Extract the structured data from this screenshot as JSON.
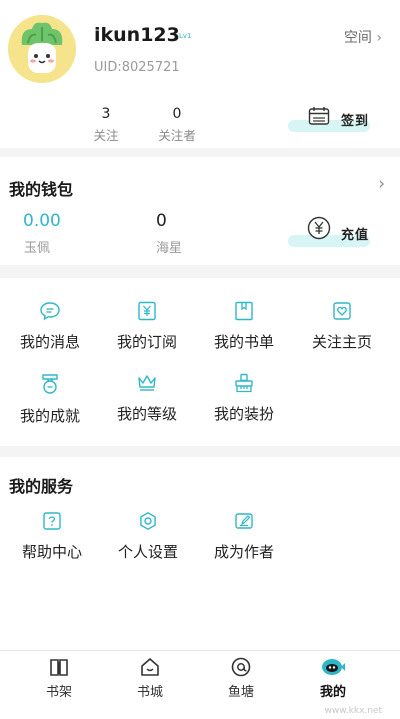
{
  "colors": {
    "accent": "#2fb7c7",
    "avatar_bg": "#f6e48d",
    "pill": "#d7f5f5",
    "gap": "#f4f4f4"
  },
  "profile": {
    "username": "ikun123",
    "level": "Lv1",
    "uid": "UID:8025721",
    "space_label": "空间",
    "following_count": "3",
    "following_label": "关注",
    "followers_count": "0",
    "followers_label": "关注者",
    "checkin_label": "签到"
  },
  "wallet": {
    "title": "我的钱包",
    "jade_value": "0.00",
    "jade_label": "玉佩",
    "star_value": "0",
    "star_label": "海星",
    "recharge_label": "充值"
  },
  "features": [
    {
      "label": "我的消息",
      "icon": "message-icon"
    },
    {
      "label": "我的订阅",
      "icon": "subscribe-icon"
    },
    {
      "label": "我的书单",
      "icon": "booklist-icon"
    },
    {
      "label": "关注主页",
      "icon": "heart-icon"
    },
    {
      "label": "我的成就",
      "icon": "medal-icon"
    },
    {
      "label": "我的等级",
      "icon": "crown-icon"
    },
    {
      "label": "我的装扮",
      "icon": "brush-icon"
    }
  ],
  "services": {
    "title": "我的服务",
    "items": [
      {
        "label": "帮助中心",
        "icon": "help-icon"
      },
      {
        "label": "个人设置",
        "icon": "settings-icon"
      },
      {
        "label": "成为作者",
        "icon": "author-icon"
      }
    ]
  },
  "nav": [
    {
      "label": "书架",
      "icon": "bookshelf-icon"
    },
    {
      "label": "书城",
      "icon": "bookstore-icon"
    },
    {
      "label": "鱼塘",
      "icon": "pond-icon"
    },
    {
      "label": "我的",
      "icon": "profile-icon",
      "active": true
    }
  ],
  "watermark": "www.kkx.net"
}
